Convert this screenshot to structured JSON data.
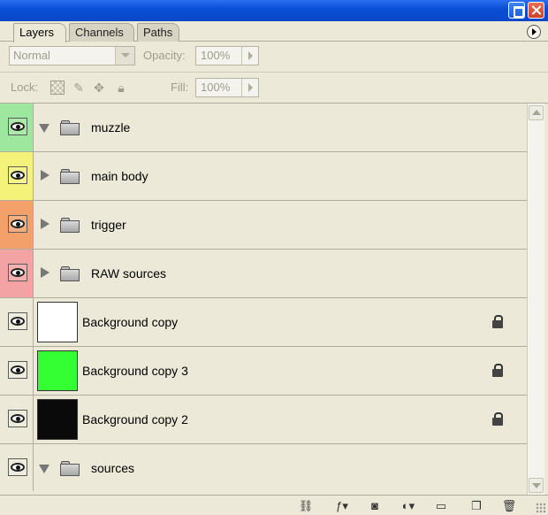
{
  "tabs": [
    {
      "label": "Layers",
      "active": true
    },
    {
      "label": "Channels",
      "active": false
    },
    {
      "label": "Paths",
      "active": false
    }
  ],
  "options": {
    "blend_mode": "Normal",
    "opacity_label": "Opacity:",
    "opacity_value": "100%",
    "lock_label": "Lock:",
    "fill_label": "Fill:",
    "fill_value": "100%"
  },
  "layers": [
    {
      "type": "group",
      "name": "muzzle",
      "expanded": true,
      "label_color": "#9ee79e"
    },
    {
      "type": "group",
      "name": "main body",
      "expanded": false,
      "label_color": "#f5f27a"
    },
    {
      "type": "group",
      "name": "trigger",
      "expanded": false,
      "label_color": "#f4a06a"
    },
    {
      "type": "group",
      "name": "RAW sources",
      "expanded": false,
      "label_color": "#f3a3a3"
    },
    {
      "type": "layer",
      "name": "Background copy",
      "thumb_color": "#ffffff",
      "locked": true
    },
    {
      "type": "layer",
      "name": "Background copy 3",
      "thumb_color": "#33ff33",
      "locked": true
    },
    {
      "type": "layer",
      "name": "Background copy 2",
      "thumb_color": "#0a0a0a",
      "locked": true
    },
    {
      "type": "group",
      "name": "sources",
      "expanded": true,
      "label_color": ""
    }
  ],
  "bottom_icons": [
    "link-icon",
    "layer-style-icon",
    "mask-icon",
    "adjustment-icon",
    "new-group-icon",
    "new-layer-icon",
    "trash-icon"
  ],
  "colors": {
    "panel_bg": "#ECE9D8",
    "titlebar": "#0a4fd6"
  }
}
